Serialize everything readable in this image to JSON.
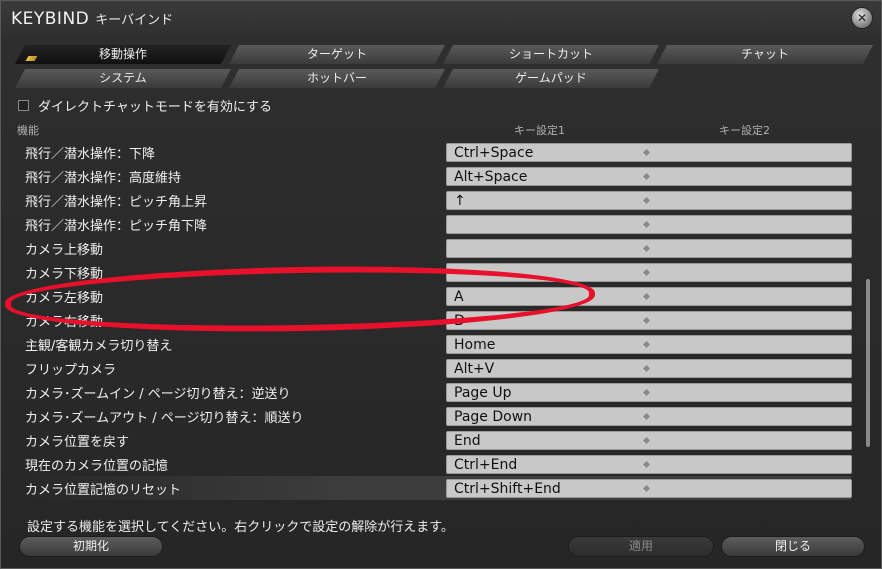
{
  "window": {
    "title_en": "KEYBIND",
    "title_jp": "キーバインド",
    "close_icon": "close-icon"
  },
  "tabs": [
    {
      "label": "移動操作",
      "active": true
    },
    {
      "label": "ターゲット",
      "active": false
    },
    {
      "label": "ショートカット",
      "active": false
    },
    {
      "label": "チャット",
      "active": false
    },
    {
      "label": "システム",
      "active": false
    },
    {
      "label": "ホットバー",
      "active": false
    },
    {
      "label": "ゲームパッド",
      "active": false
    }
  ],
  "direct_chat": {
    "label": "ダイレクトチャットモードを有効にする",
    "checked": false
  },
  "columns": {
    "function": "機能",
    "key1": "キー設定1",
    "key2": "キー設定2"
  },
  "rows": [
    {
      "label": "飛行／潜水操作：下降",
      "key1": "Ctrl+Space",
      "key2": ""
    },
    {
      "label": "飛行／潜水操作：高度維持",
      "key1": "Alt+Space",
      "key2": ""
    },
    {
      "label": "飛行／潜水操作：ピッチ角上昇",
      "key1": "↑",
      "key2": ""
    },
    {
      "label": "飛行／潜水操作：ピッチ角下降",
      "key1": "",
      "key2": ""
    },
    {
      "label": "カメラ上移動",
      "key1": "",
      "key2": ""
    },
    {
      "label": "カメラ下移動",
      "key1": "",
      "key2": ""
    },
    {
      "label": "カメラ左移動",
      "key1": "A",
      "key2": ""
    },
    {
      "label": "カメラ右移動",
      "key1": "D",
      "key2": ""
    },
    {
      "label": "主観/客観カメラ切り替え",
      "key1": "Home",
      "key2": ""
    },
    {
      "label": "フリップカメラ",
      "key1": "Alt+V",
      "key2": ""
    },
    {
      "label": "カメラ･ズームイン / ページ切り替え：逆送り",
      "key1": "Page Up",
      "key2": ""
    },
    {
      "label": "カメラ･ズームアウト / ページ切り替え：順送り",
      "key1": "Page Down",
      "key2": ""
    },
    {
      "label": "カメラ位置を戻す",
      "key1": "End",
      "key2": ""
    },
    {
      "label": "現在のカメラ位置の記憶",
      "key1": "Ctrl+End",
      "key2": ""
    },
    {
      "label": "カメラ位置記憶のリセット",
      "key1": "Ctrl+Shift+End",
      "key2": ""
    }
  ],
  "selected_row": "カメラ位置記憶のリセット",
  "status_text": "設定する機能を選択してください。右クリックで設定の解除が行えます。",
  "buttons": {
    "reset": "初期化",
    "apply": "適用",
    "close": "閉じる"
  },
  "colors": {
    "annotation": "#e8102a",
    "active_mark": "#e8c34a"
  }
}
